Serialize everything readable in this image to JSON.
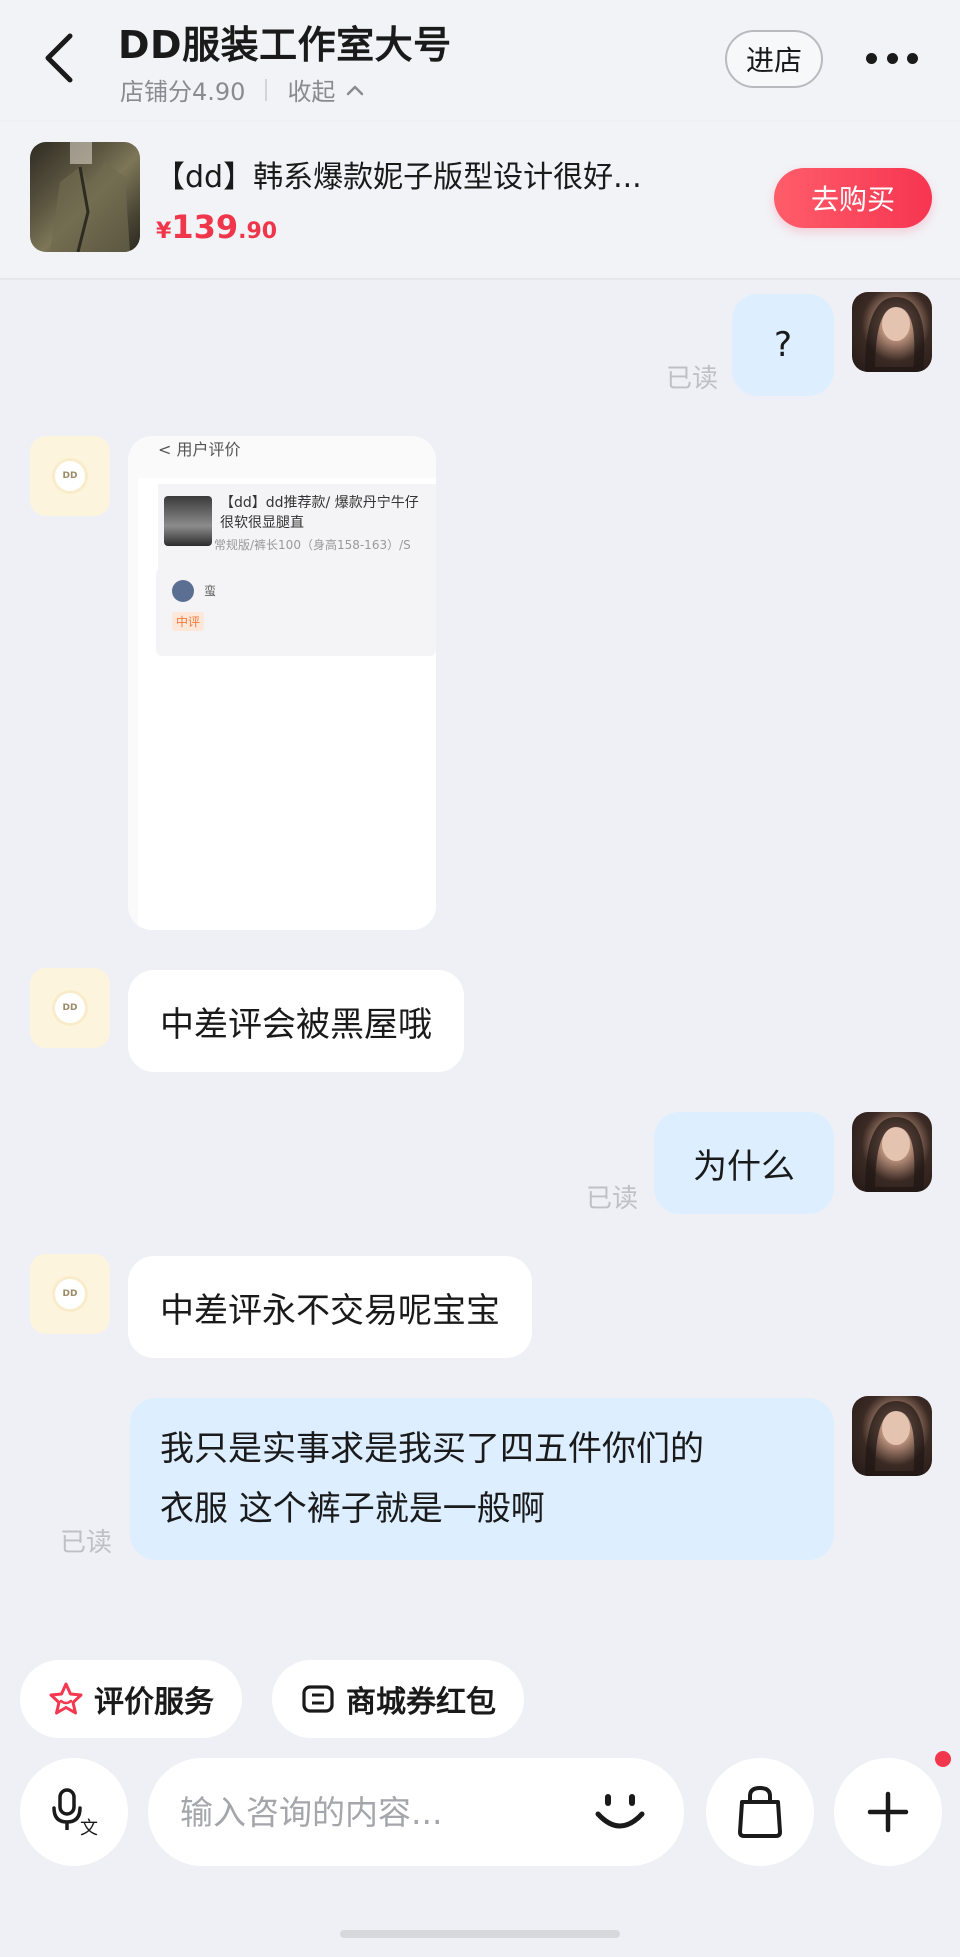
{
  "header": {
    "title": "DD服装工作室大号",
    "store_score": "店铺分4.90",
    "collapse_label": "收起",
    "enter_store_label": "进店"
  },
  "product": {
    "title": "【dd】韩系爆款妮子版型设计很好...",
    "price_symbol": "¥",
    "price_int": "139",
    "price_dec": ".90",
    "buy_label": "去购买"
  },
  "chat": {
    "read_label": "已读",
    "shop_logo_text": "DD",
    "messages": [
      {
        "from": "me",
        "text": "?",
        "read": "已读"
      },
      {
        "from": "shop",
        "type": "image",
        "image": {
          "header": "< 用户评价",
          "line1": "【dd】dd推荐款/ 爆款丹宁牛仔",
          "line2": "很软很显腿直",
          "line3": "常规版/裤长100（身高158-163）/S",
          "reviewer": "蛮",
          "tag": "中评"
        }
      },
      {
        "from": "shop",
        "text": "中差评会被黑屋哦"
      },
      {
        "from": "me",
        "text": "为什么",
        "read": "已读"
      },
      {
        "from": "shop",
        "text": "中差评永不交易呢宝宝"
      },
      {
        "from": "me",
        "text_line1": "我只是实事求是我买了四五件你们的",
        "text_line2": "衣服 这个裤子就是一般啊",
        "read": "已读"
      }
    ]
  },
  "quick_actions": {
    "rate_service": "评价服务",
    "coupons": "商城券红包"
  },
  "input": {
    "placeholder": "输入咨询的内容..."
  },
  "icons": {
    "back": "chevron-left-icon",
    "more": "more-dots-icon",
    "voice": "voice-to-text-icon",
    "emoji": "smile-icon",
    "bag": "shopping-bag-icon",
    "plus": "plus-icon",
    "star": "star-icon",
    "coupon": "coupon-icon"
  },
  "colors": {
    "accent_red": "#f63551",
    "my_bubble": "#dceeff",
    "background": "#eff0f5"
  }
}
